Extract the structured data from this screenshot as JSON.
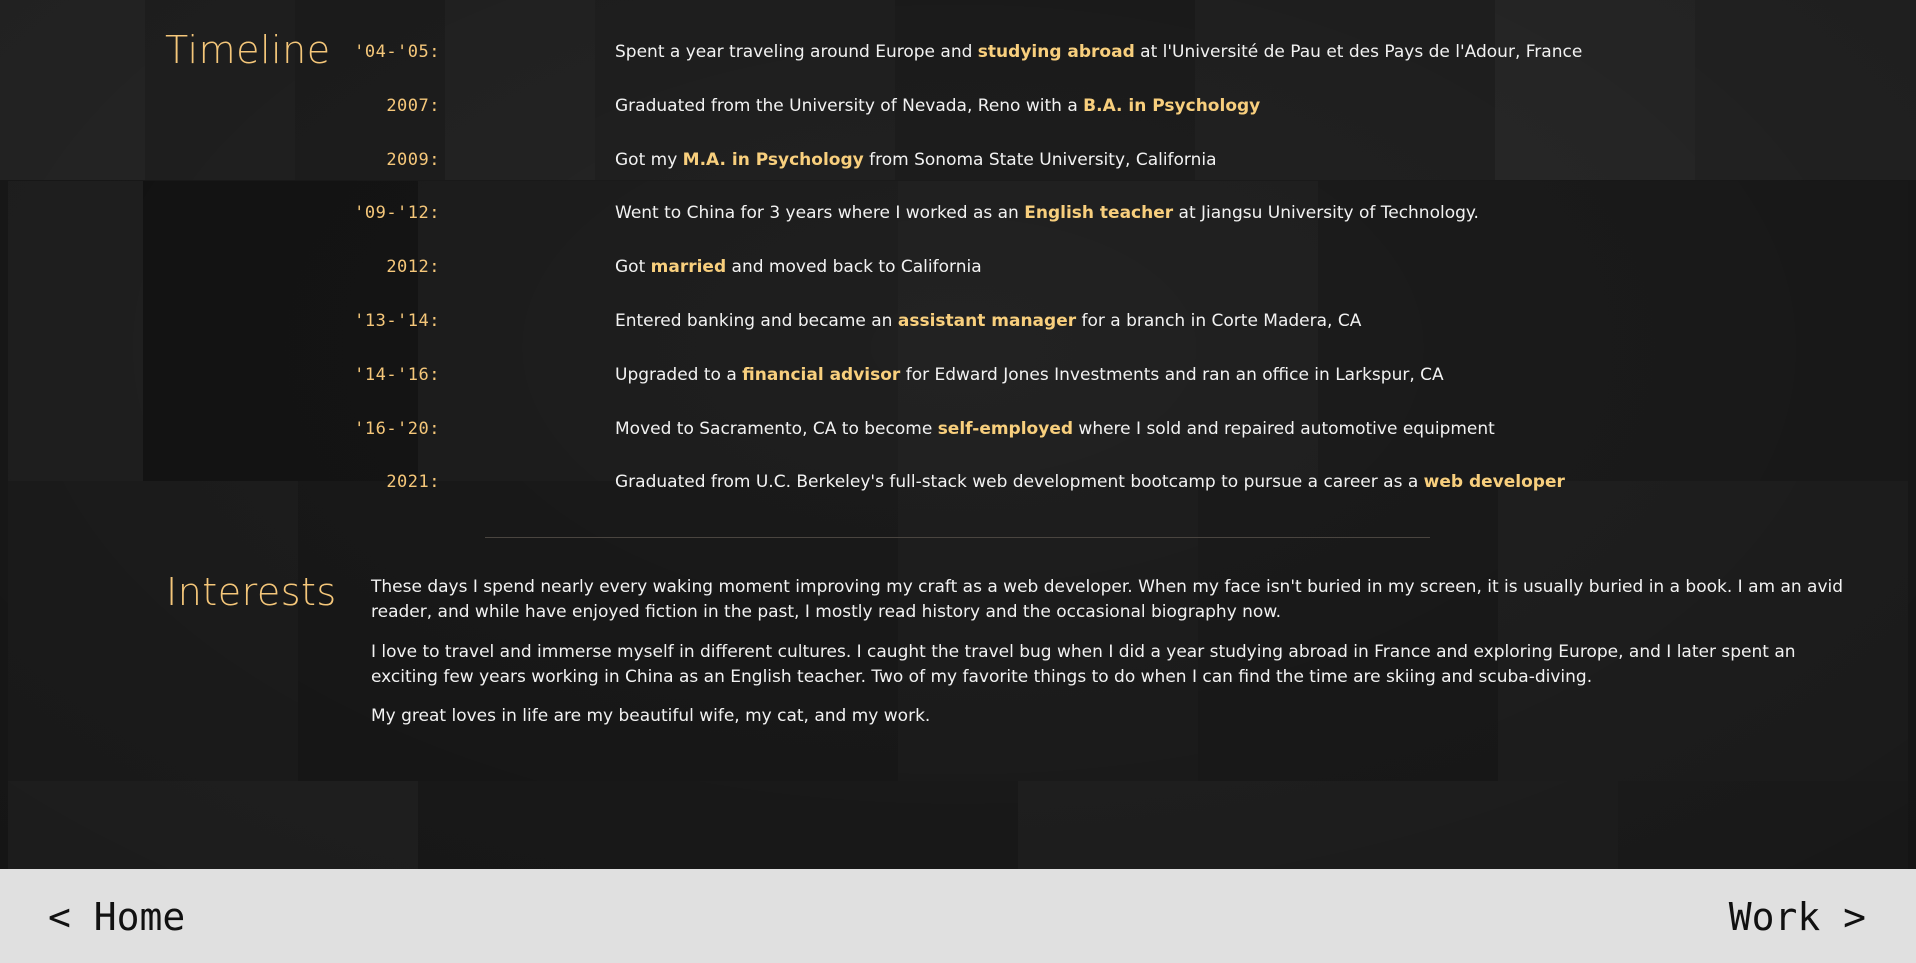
{
  "timeline": {
    "title": "Timeline",
    "entries": [
      {
        "year": "'04-'05:",
        "before": "Spent a year traveling around Europe and ",
        "highlight": "studying abroad",
        "after": " at l'Université de Pau et des Pays de l'Adour, France"
      },
      {
        "year": "2007:",
        "before": "Graduated from the University of Nevada, Reno with a ",
        "highlight": "B.A. in Psychology",
        "after": ""
      },
      {
        "year": "2009:",
        "before": "Got my ",
        "highlight": "M.A. in Psychology",
        "after": " from Sonoma State University, California"
      },
      {
        "year": "'09-'12:",
        "before": "Went to China for 3 years where I worked as an ",
        "highlight": "English teacher",
        "after": " at Jiangsu University of Technology."
      },
      {
        "year": "2012:",
        "before": "Got ",
        "highlight": "married",
        "after": " and moved back to California"
      },
      {
        "year": "'13-'14:",
        "before": "Entered banking and became an ",
        "highlight": "assistant manager",
        "after": " for a branch in Corte Madera, CA"
      },
      {
        "year": "'14-'16:",
        "before": "Upgraded to a ",
        "highlight": "financial advisor",
        "after": " for Edward Jones Investments and ran an office in Larkspur, CA"
      },
      {
        "year": "'16-'20:",
        "before": "Moved to Sacramento, CA to become ",
        "highlight": "self-employed",
        "after": " where I sold and repaired automotive equipment"
      },
      {
        "year": "2021:",
        "before": "Graduated from U.C. Berkeley's full-stack web development bootcamp to pursue a career as a ",
        "highlight": "web developer",
        "after": ""
      }
    ]
  },
  "interests": {
    "title": "Interests",
    "paragraphs": [
      "These days I spend nearly every waking moment improving my craft as a web developer. When my face isn't buried in my screen, it is usually buried in a book. I am an avid reader, and while have enjoyed fiction in the past, I mostly read history and the occasional biography now.",
      "I love to travel and immerse myself in different cultures. I caught the travel bug when I did a year studying abroad in France and exploring Europe, and I later spent an exciting few years working in China as an English teacher. Two of my favorite things to do when I can find the time are skiing and scuba-diving.",
      "My great loves in life are my beautiful wife, my cat, and my work."
    ]
  },
  "footer": {
    "home_label": "< Home",
    "work_label": "Work >"
  },
  "colors": {
    "accent": "#f5c77a",
    "highlight": "#f8cf7d",
    "text": "#f2f2f2",
    "background": "#1c1c1c",
    "footer_bg": "#e0e0e0",
    "footer_text": "#111111"
  }
}
